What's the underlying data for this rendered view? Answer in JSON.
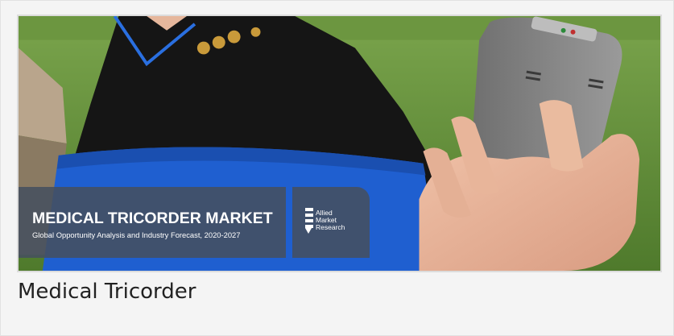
{
  "banner": {
    "title": "MEDICAL TRICORDER MARKET",
    "subtitle": "Global Opportunity Analysis and Industry Forecast, 2020-2027"
  },
  "logo": {
    "line1": "Allied",
    "line2": "Market",
    "line3": "Research"
  },
  "caption": "Medical Tricorder",
  "colors": {
    "banner_bg": "#46505f",
    "grass": "#5f8a3a",
    "jacket_blue": "#1f5fd0",
    "device_gray": "#8a8a8a",
    "caption_text": "#222222"
  }
}
